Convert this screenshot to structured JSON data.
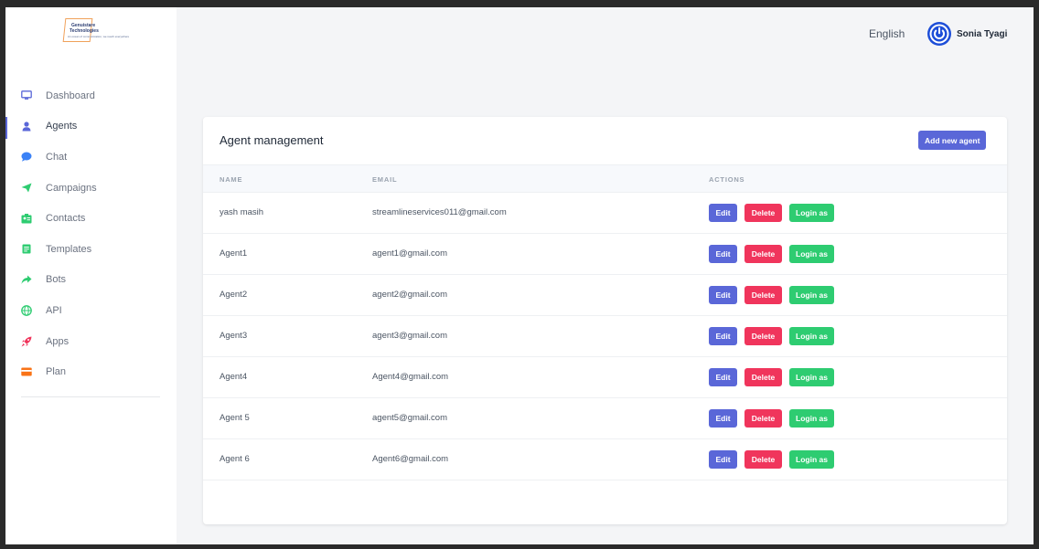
{
  "brand": {
    "line1": "Genuistare",
    "line2": "Technologies",
    "tagline": "An ocean of communication, we reach everywhere"
  },
  "sidebar": {
    "items": [
      {
        "label": "Dashboard",
        "icon": "monitor-icon",
        "active": false
      },
      {
        "label": "Agents",
        "icon": "user-icon",
        "active": true
      },
      {
        "label": "Chat",
        "icon": "chat-bubble-icon",
        "active": false
      },
      {
        "label": "Campaigns",
        "icon": "send-icon",
        "active": false
      },
      {
        "label": "Contacts",
        "icon": "contact-card-icon",
        "active": false
      },
      {
        "label": "Templates",
        "icon": "document-icon",
        "active": false
      },
      {
        "label": "Bots",
        "icon": "share-arrow-icon",
        "active": false
      },
      {
        "label": "API",
        "icon": "globe-icon",
        "active": false
      },
      {
        "label": "Apps",
        "icon": "rocket-icon",
        "active": false
      },
      {
        "label": "Plan",
        "icon": "credit-card-icon",
        "active": false
      }
    ]
  },
  "topbar": {
    "language": "English",
    "user_name": "Sonia Tyagi"
  },
  "card": {
    "title": "Agent management",
    "add_button": "Add new agent",
    "columns": [
      "NAME",
      "EMAIL",
      "ACTIONS"
    ],
    "rows": [
      {
        "name": "yash masih",
        "email": "streamlineservices011@gmail.com"
      },
      {
        "name": "Agent1",
        "email": "agent1@gmail.com"
      },
      {
        "name": "Agent2",
        "email": "agent2@gmail.com"
      },
      {
        "name": "Agent3",
        "email": "agent3@gmail.com"
      },
      {
        "name": "Agent4",
        "email": "Agent4@gmail.com"
      },
      {
        "name": "Agent 5",
        "email": "agent5@gmail.com"
      },
      {
        "name": "Agent 6",
        "email": "Agent6@gmail.com"
      }
    ],
    "actions": {
      "edit": "Edit",
      "delete": "Delete",
      "login": "Login as"
    }
  },
  "colors": {
    "primary": "#5a67d8",
    "danger": "#f0355c",
    "success": "#2ecc71",
    "avatar_blue": "#1d4ed8"
  }
}
